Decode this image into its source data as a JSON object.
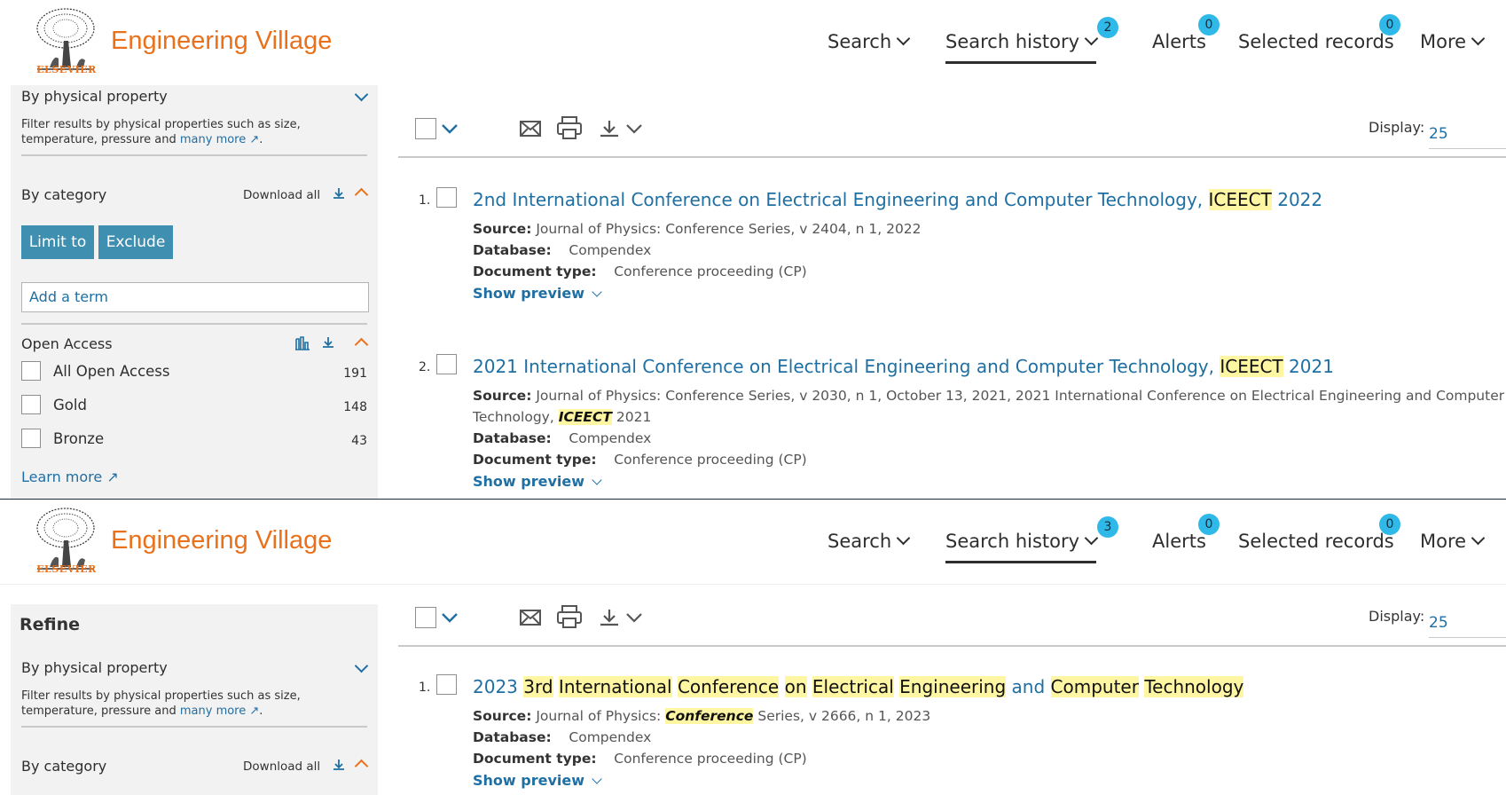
{
  "brand": {
    "name": "Engineering Village",
    "publisher": "ELSEVIER"
  },
  "panel1": {
    "nav": {
      "search": "Search",
      "history": "Search history",
      "history_count": "2",
      "alerts": "Alerts",
      "alerts_count": "0",
      "selected": "Selected records",
      "selected_count": "0",
      "more": "More"
    },
    "sidebar": {
      "physical_property": "By physical property",
      "physical_desc": "Filter results by physical properties such as size, temperature, pressure and",
      "many_more": "many more",
      "category": "By category",
      "download_all": "Download all",
      "limit_to": "Limit to",
      "exclude": "Exclude",
      "add_term": "Add a term",
      "open_access": "Open Access",
      "oa_items": [
        {
          "label": "All Open Access",
          "count": "191"
        },
        {
          "label": "Gold",
          "count": "148"
        },
        {
          "label": "Bronze",
          "count": "43"
        }
      ],
      "learn_more": "Learn more"
    },
    "display": {
      "label": "Display:",
      "value": "25"
    },
    "results": [
      {
        "num": "1.",
        "title_a": "2nd International Conference on Electrical Engineering and Computer Technology, ",
        "title_hl": "ICEECT",
        "title_b": " 2022",
        "source_label": "Source:",
        "source": "Journal of Physics: Conference Series, v 2404, n 1, 2022",
        "db_label": "Database:",
        "db": "Compendex",
        "dt_label": "Document type:",
        "dt": "Conference proceeding (CP)",
        "preview": "Show preview"
      },
      {
        "num": "2.",
        "title_a": "2021 International Conference on Electrical Engineering and Computer Technology, ",
        "title_hl": "ICEECT",
        "title_b": " 2021",
        "source_label": "Source:",
        "source": "Journal of Physics: Conference Series, v 2030, n 1, October 13, 2021, 2021 International Conference on Electrical Engineering and Computer",
        "source2_a": "Technology, ",
        "source2_hl": "ICEECT",
        "source2_b": " 2021",
        "db_label": "Database:",
        "db": "Compendex",
        "dt_label": "Document type:",
        "dt": "Conference proceeding (CP)",
        "preview": "Show preview"
      }
    ]
  },
  "panel2": {
    "nav": {
      "search": "Search",
      "history": "Search history",
      "history_count": "3",
      "alerts": "Alerts",
      "alerts_count": "0",
      "selected": "Selected records",
      "selected_count": "0",
      "more": "More"
    },
    "sidebar": {
      "refine": "Refine",
      "physical_property": "By physical property",
      "physical_desc": "Filter results by physical properties such as size, temperature, pressure and",
      "many_more": "many more",
      "category": "By category",
      "download_all": "Download all"
    },
    "display": {
      "label": "Display:",
      "value": "25"
    },
    "results": [
      {
        "num": "1.",
        "title_words": [
          "2023",
          "3rd",
          "International",
          "Conference",
          "on",
          "Electrical",
          "Engineering",
          "and",
          "Computer",
          "Technology"
        ],
        "title_hl_flags": [
          false,
          true,
          true,
          true,
          true,
          true,
          true,
          false,
          true,
          true
        ],
        "source_label": "Source:",
        "source_a": "Journal of Physics: ",
        "source_hl": "Conference",
        "source_b": " Series, v 2666, n 1, 2023",
        "db_label": "Database:",
        "db": "Compendex",
        "dt_label": "Document type:",
        "dt": "Conference proceeding (CP)",
        "preview": "Show preview"
      }
    ]
  }
}
